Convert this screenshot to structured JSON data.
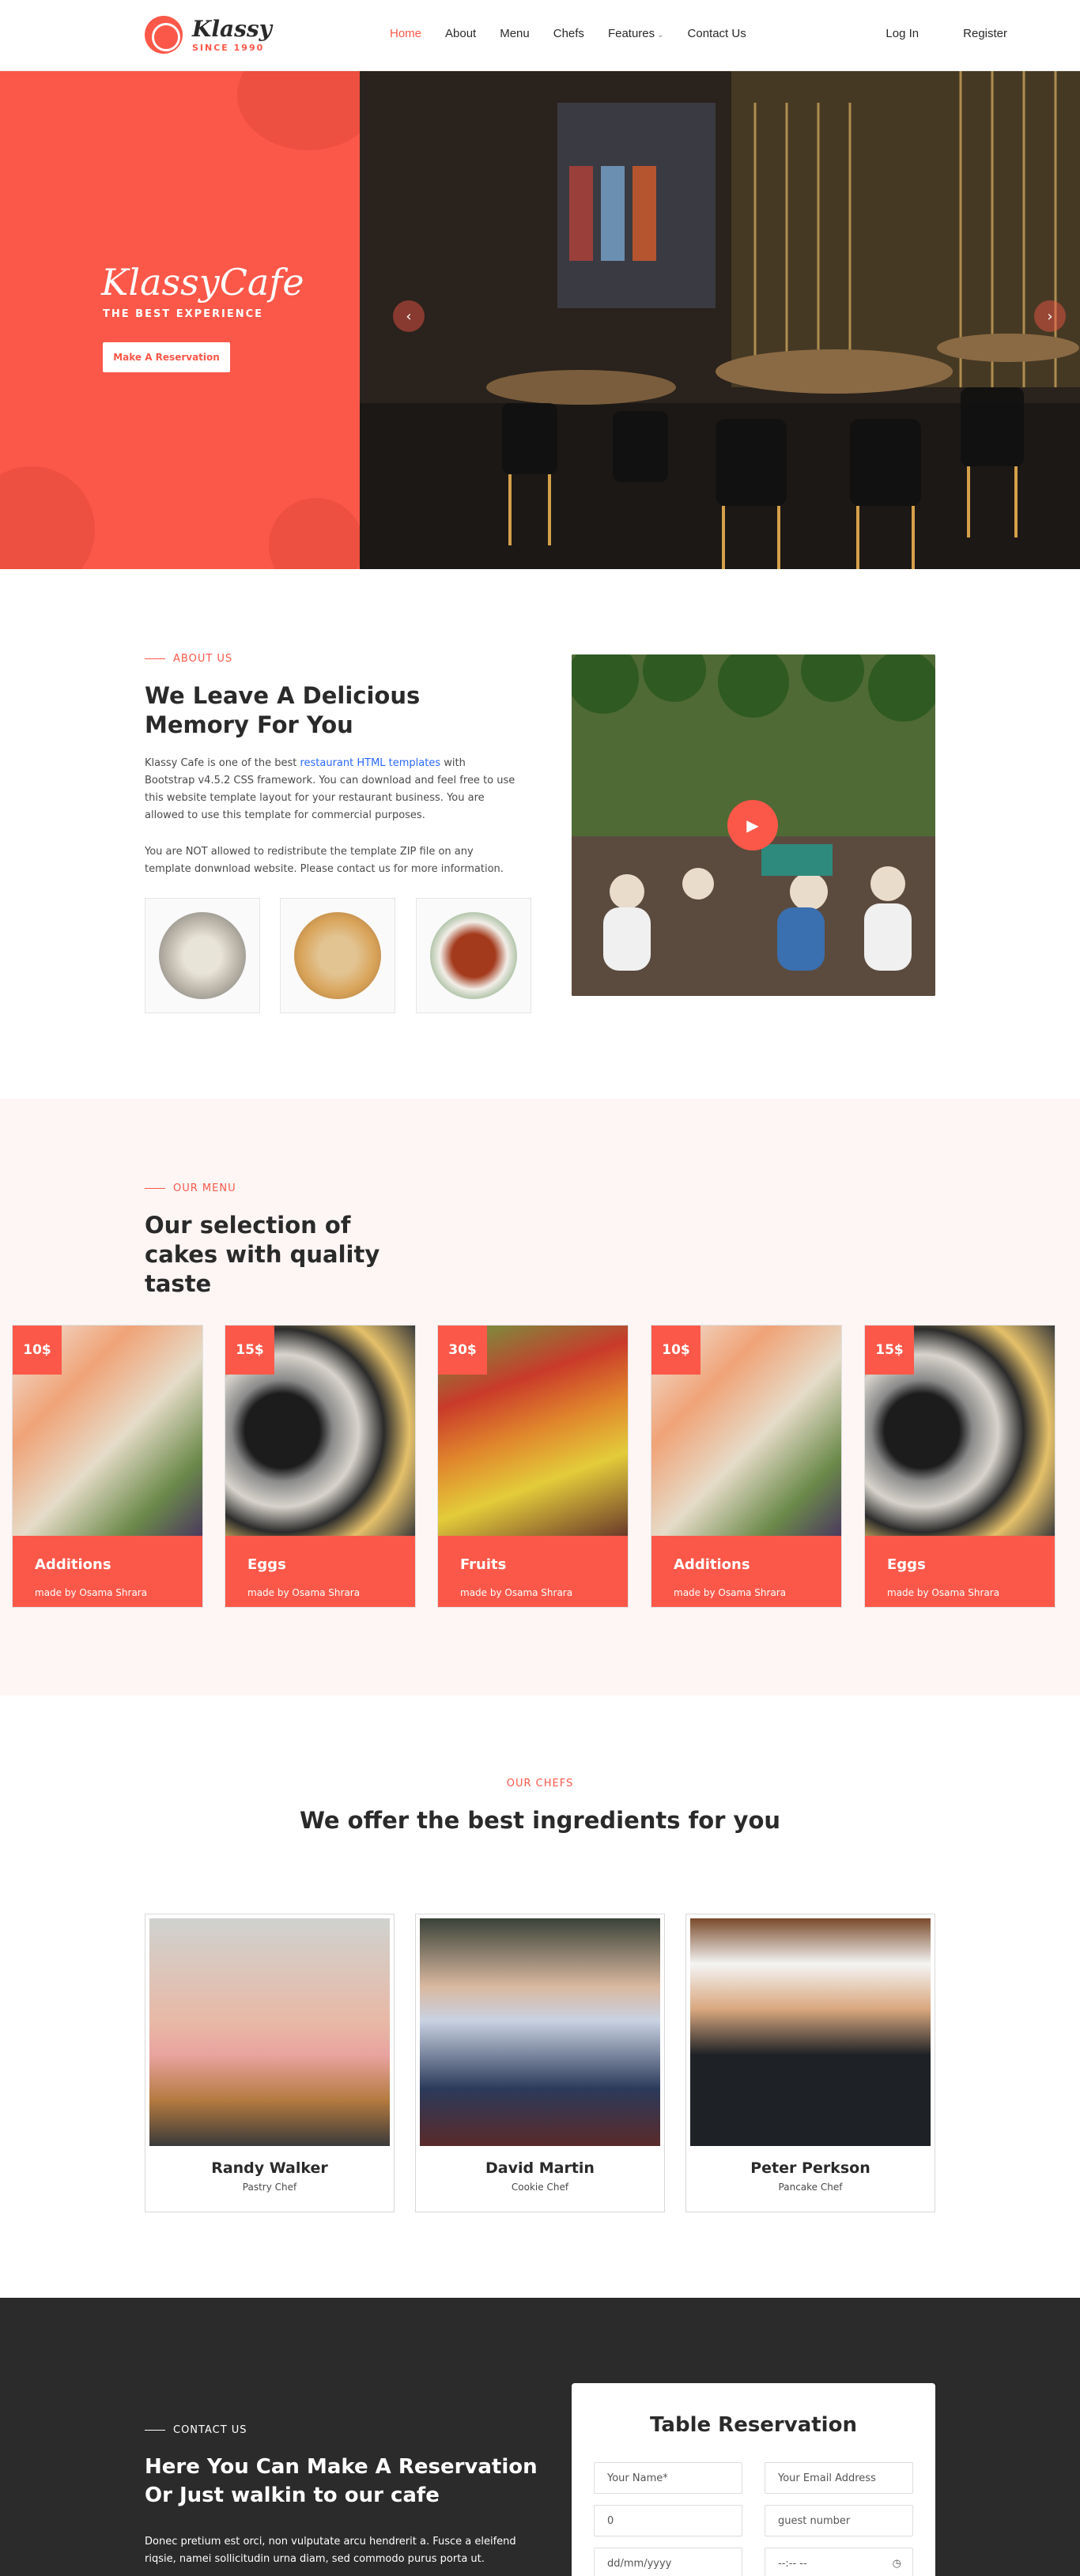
{
  "header": {
    "logo_name": "Klassy",
    "logo_since": "SINCE 1990",
    "nav": [
      {
        "label": "Home"
      },
      {
        "label": "About"
      },
      {
        "label": "Menu"
      },
      {
        "label": "Chefs"
      },
      {
        "label": "Features"
      },
      {
        "label": "Contact Us"
      }
    ],
    "login": "Log In",
    "register": "Register"
  },
  "hero": {
    "title": "KlassyCafe",
    "subtitle": "THE BEST EXPERIENCE",
    "button": "Make A Reservation"
  },
  "about": {
    "tag": "ABOUT US",
    "title": "We Leave A Delicious Memory For You",
    "p1_before": "Klassy Cafe is one of the best ",
    "p1_link": "restaurant HTML templates",
    "p1_after": " with Bootstrap v4.5.2 CSS framework. You can download and feel free to use this website template layout for your restaurant business. You are allowed to use this template for commercial purposes.",
    "p2": "You are NOT allowed to redistribute the template ZIP file on any template donwnload website. Please contact us for more information."
  },
  "menu": {
    "tag": "OUR MENU",
    "title": "Our selection of cakes with quality taste",
    "items": [
      {
        "price": "10$",
        "name": "Additions",
        "by": "made by Osama Shrara"
      },
      {
        "price": "15$",
        "name": "Eggs",
        "by": "made by Osama Shrara"
      },
      {
        "price": "30$",
        "name": "Fruits",
        "by": "made by Osama Shrara"
      },
      {
        "price": "10$",
        "name": "Additions",
        "by": "made by Osama Shrara"
      },
      {
        "price": "15$",
        "name": "Eggs",
        "by": "made by Osama Shrara"
      }
    ]
  },
  "chefs": {
    "tag": "OUR CHEFS",
    "title": "We offer the best ingredients for you",
    "items": [
      {
        "name": "Randy Walker",
        "role": "Pastry Chef"
      },
      {
        "name": "David Martin",
        "role": "Cookie Chef"
      },
      {
        "name": "Peter Perkson",
        "role": "Pancake Chef"
      }
    ]
  },
  "contact": {
    "tag": "CONTACT US",
    "title": "Here You Can Make A Reservation Or Just walkin to our cafe",
    "p": "Donec pretium est orci, non vulputate arcu hendrerit a. Fusce a eleifend riqsie, namei sollicitudin urna diam, sed commodo purus porta ut.",
    "form_title": "Table Reservation",
    "name_placeholder": "Your Name*",
    "email_placeholder": "Your Email Address",
    "phone_value": "0",
    "guests_placeholder": "guest number",
    "date_placeholder": "dd/mm/yyyy",
    "time_placeholder": "--:-- --"
  },
  "colors": {
    "accent": "#fb5849",
    "dark": "#2b2b2b"
  }
}
